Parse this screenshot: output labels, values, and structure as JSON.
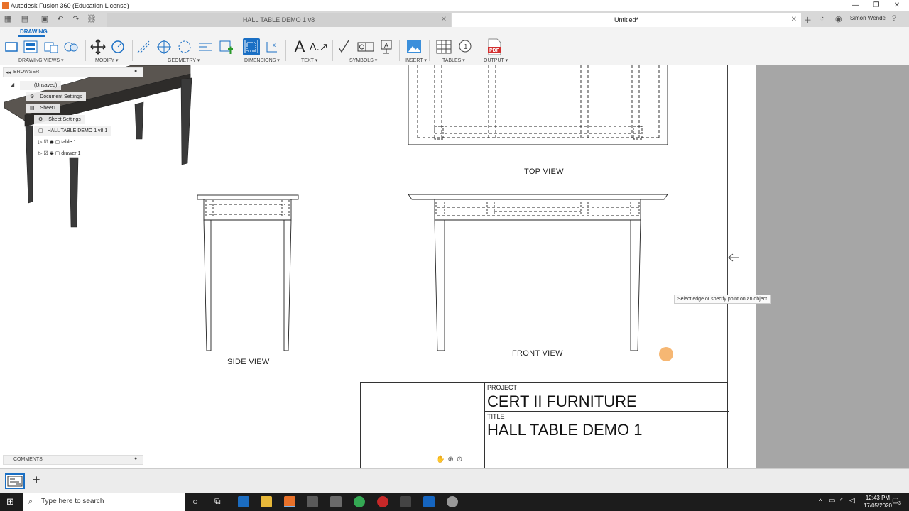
{
  "window": {
    "title": "Autodesk Fusion 360 (Education License)"
  },
  "tabs": [
    {
      "label": "HALL TABLE DEMO 1 v8"
    },
    {
      "label": "Untitled*"
    }
  ],
  "user": {
    "name": "Simon Wende"
  },
  "ribbon": {
    "workspace": "DRAWING",
    "groups": {
      "drawing_views": "DRAWING VIEWS ▾",
      "modify": "MODIFY ▾",
      "geometry": "GEOMETRY ▾",
      "dimensions": "DIMENSIONS ▾",
      "text": "TEXT ▾",
      "symbols": "SYMBOLS ▾",
      "insert": "INSERT ▾",
      "tables": "TABLES ▾",
      "output": "OUTPUT ▾"
    }
  },
  "browser": {
    "title": "BROWSER",
    "items": {
      "root": "(Unsaved)",
      "document_settings": "Document Settings",
      "sheet": "Sheet1",
      "sheet_settings": "Sheet Settings",
      "model": "HALL TABLE DEMO 1 v8:1",
      "table": "table:1",
      "drawer": "drawer:1"
    }
  },
  "comments": {
    "title": "COMMENTS"
  },
  "views": {
    "top": "TOP VIEW",
    "side": "SIDE VIEW",
    "front": "FRONT VIEW"
  },
  "title_block": {
    "project_label": "PROJECT",
    "project": "CERT II FURNITURE",
    "title_label": "TITLE",
    "title": "HALL TABLE DEMO 1"
  },
  "tooltip": "Select edge or specify point on an object",
  "taskbar": {
    "search_placeholder": "Type here to search",
    "time": "12:43 PM",
    "date": "17/05/2020",
    "notification_count": "3"
  },
  "colors": {
    "accent": "#1a6fc4",
    "sheet_margin": "#a6a6a6",
    "fusion_orange": "#e8712a"
  }
}
